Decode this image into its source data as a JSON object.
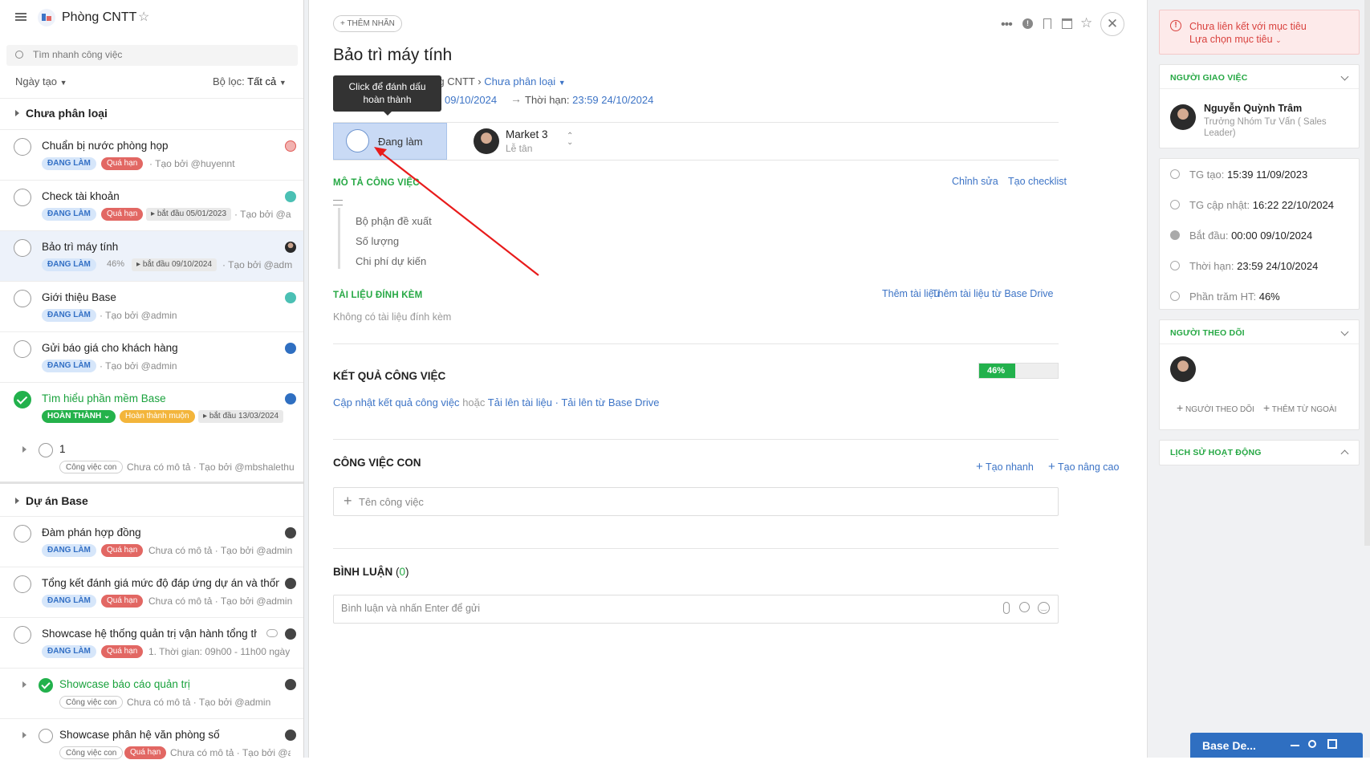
{
  "left": {
    "project_title": "Phòng CNTT",
    "search_placeholder": "Tìm nhanh công việc",
    "sort_label": "Ngày tạo",
    "filter_label": "Bộ lọc:",
    "filter_value": "Tất cả",
    "groups": [
      {
        "title": "Chưa phân loại"
      },
      {
        "title": "Dự án Base"
      }
    ],
    "tasks": [
      {
        "title": "Chuẩn bị nước phòng họp",
        "status": "ĐANG LÀM",
        "overdue": "Quá hạn",
        "meta": "· Tạo bởi @huyennt"
      },
      {
        "title": "Check tài khoản",
        "status": "ĐANG LÀM",
        "overdue": "Quá hạn",
        "start": "bắt đầu 05/01/2023",
        "meta": "· Tạo bởi @a"
      },
      {
        "title": "Bảo trì máy tính",
        "status": "ĐANG LÀM",
        "percent": "46%",
        "start": "bắt đầu 09/10/2024",
        "meta": "· Tạo bởi @adm"
      },
      {
        "title": "Giới thiệu Base",
        "status": "ĐANG LÀM",
        "meta": "· Tạo bởi @admin"
      },
      {
        "title": "Gửi báo giá cho khách hàng",
        "status": "ĐANG LÀM",
        "meta": "· Tạo bởi @admin"
      },
      {
        "title": "Tìm hiểu phần mềm Base",
        "status": "HOÀN THÀNH",
        "late": "Hoàn thành muộn",
        "start": "bắt đầu 13/03/2024"
      },
      {
        "title": "1",
        "sub": "Công việc con",
        "meta": "Chưa có mô tả · Tạo bởi @mbshalethu"
      },
      {
        "title": "Đàm phán hợp đồng",
        "status": "ĐANG LÀM",
        "overdue": "Quá hạn",
        "meta": "Chưa có mô tả · Tạo bởi @admin"
      },
      {
        "title": "Tổng kết đánh giá mức độ đáp ứng dự án và thống",
        "status": "ĐANG LÀM",
        "overdue": "Quá hạn",
        "meta": "Chưa có mô tả · Tạo bởi @admin"
      },
      {
        "title": "Showcase hệ thống quản trị vận hành tổng thể",
        "status": "ĐANG LÀM",
        "overdue": "Quá hạn",
        "meta": "1. Thời gian: 09h00 - 11h00 ngày"
      },
      {
        "title": "Showcase báo cáo quản trị",
        "sub": "Công việc con",
        "meta": "Chưa có mô tả · Tạo bởi @admin"
      },
      {
        "title": "Showcase phân hệ văn phòng số",
        "sub": "Công việc con",
        "overdue": "Quá hạn",
        "meta": "Chưa có mô tả · Tạo bởi @ad"
      }
    ]
  },
  "main": {
    "add_label_btn": "+ THÊM NHÃN",
    "task_title": "Bảo trì máy tính",
    "breadcrumb_project": "Phòng CNTT",
    "breadcrumb_sep": "›",
    "breadcrumb_group": "Chưa phân loại",
    "start_date": "09/10/2024",
    "deadline_label": "Thời hạn:",
    "deadline_value": "23:59 24/10/2024",
    "tooltip": "Click để đánh dấu hoàn thành",
    "status_label": "Đang làm",
    "assignee_name": "Market 3",
    "assignee_role": "Lễ tân",
    "desc_heading": "MÔ TẢ CÔNG VIỆC",
    "edit_link": "Chỉnh sửa",
    "checklist_link": "Tạo checklist",
    "desc_lines": [
      "Bộ phận đề xuất",
      "Số lượng",
      "Chi phí dự kiến"
    ],
    "attach_heading": "TÀI LIỆU ĐÍNH KÈM",
    "add_doc_link": "Thêm tài liệu",
    "add_drive_link": "Thêm tài liệu từ Base Drive",
    "no_attach": "Không có tài liệu đính kèm",
    "result_heading": "KẾT QUẢ CÔNG VIỆC",
    "result_percent": "46%",
    "result_progress": 0.46,
    "update_result_link": "Cập nhật kết quả công việc",
    "or_text": "hoặc",
    "upload_link": "Tải lên tài liệu",
    "dot_sep": "·",
    "upload_drive_link": "Tải lên từ Base Drive",
    "subtask_heading": "CÔNG VIỆC CON",
    "quick_create": "Tạo nhanh",
    "adv_create": "Tạo nâng cao",
    "subtask_placeholder": "Tên công việc",
    "comment_heading": "BÌNH LUẬN",
    "comment_count": "0",
    "comment_placeholder": "Bình luận và nhấn Enter để gửi"
  },
  "right": {
    "goal_warning": "Chưa liên kết với mục tiêu",
    "goal_select": "Lựa chọn mục tiêu",
    "assigner_heading": "NGƯỜI GIAO VIỆC",
    "assigner_name": "Nguyễn Quỳnh Trâm",
    "assigner_role": "Trưởng Nhóm Tư Vấn ( Sales Leader)",
    "info": [
      {
        "label": "TG tạo:",
        "value": "15:39 11/09/2023"
      },
      {
        "label": "TG cập nhật:",
        "value": "16:22 22/10/2024"
      },
      {
        "label": "Bắt đầu:",
        "value": "00:00 09/10/2024"
      },
      {
        "label": "Thời hạn:",
        "value": "23:59 24/10/2024"
      },
      {
        "label": "Phần trăm HT:",
        "value": "46%"
      }
    ],
    "followers_heading": "NGƯỜI THEO DÕI",
    "add_follower": "NGƯỜI THEO DÕI",
    "add_external": "THÊM TỪ NGOÀI",
    "history_heading": "LỊCH SỬ HOẠT ĐỘNG",
    "drive_widget": "Base De..."
  },
  "colors": {
    "accent": "#3d74c6",
    "green": "#26a844",
    "overdue": "#e26763",
    "status_bg": "#c9daf5"
  }
}
